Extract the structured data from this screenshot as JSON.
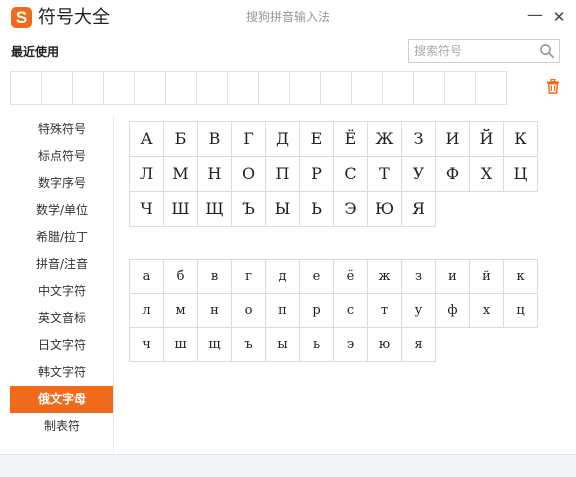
{
  "window": {
    "app_title": "符号大全",
    "subtitle": "搜狗拼音输入法",
    "logo_letter": "S",
    "minimize_glyph": "—",
    "close_glyph": "✕"
  },
  "recent": {
    "label": "最近使用",
    "slot_count": 16
  },
  "search": {
    "placeholder": "搜索符号",
    "value": ""
  },
  "categories": [
    {
      "label": "特殊符号",
      "active": false
    },
    {
      "label": "标点符号",
      "active": false
    },
    {
      "label": "数字序号",
      "active": false
    },
    {
      "label": "数学/单位",
      "active": false
    },
    {
      "label": "希腊/拉丁",
      "active": false
    },
    {
      "label": "拼音/注音",
      "active": false
    },
    {
      "label": "中文字符",
      "active": false
    },
    {
      "label": "英文音标",
      "active": false
    },
    {
      "label": "日文字符",
      "active": false
    },
    {
      "label": "韩文字符",
      "active": false
    },
    {
      "label": "俄文字母",
      "active": true
    },
    {
      "label": "制表符",
      "active": false
    }
  ],
  "uppercase": [
    "А",
    "Б",
    "В",
    "Г",
    "Д",
    "Е",
    "Ё",
    "Ж",
    "З",
    "И",
    "Й",
    "К",
    "Л",
    "М",
    "Н",
    "О",
    "П",
    "Р",
    "С",
    "Т",
    "У",
    "Ф",
    "Х",
    "Ц",
    "Ч",
    "Ш",
    "Щ",
    "Ъ",
    "Ы",
    "Ь",
    "Э",
    "Ю",
    "Я"
  ],
  "lowercase": [
    "а",
    "б",
    "в",
    "г",
    "д",
    "е",
    "ё",
    "ж",
    "з",
    "и",
    "й",
    "к",
    "л",
    "м",
    "н",
    "о",
    "п",
    "р",
    "с",
    "т",
    "у",
    "ф",
    "х",
    "ц",
    "ч",
    "ш",
    "щ",
    "ъ",
    "ы",
    "ь",
    "э",
    "ю",
    "я"
  ],
  "colors": {
    "accent": "#f06a1c",
    "border": "#dcdcdc"
  },
  "icons": {
    "logo": "sogou-logo-icon",
    "search": "search-icon",
    "trash": "trash-icon"
  }
}
